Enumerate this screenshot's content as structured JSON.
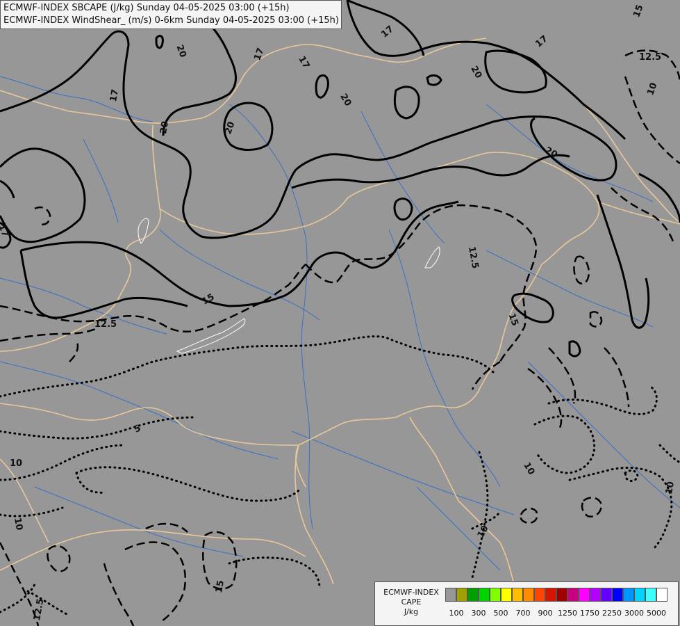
{
  "title": {
    "line1": "ECMWF-INDEX SBCAPE (J/kg) Sunday 04-05-2025 03:00 (+15h)",
    "line2": "ECMWF-INDEX WindShear_ (m/s) 0-6km Sunday 04-05-2025 03:00 (+15h)"
  },
  "colors": {
    "background": "#979797",
    "borders": "#e8c89a",
    "rivers": "#3a6fc4",
    "contours": "#000000"
  },
  "contour_labels": {
    "l20a": "20",
    "l20b": "20",
    "l20c": "20",
    "l20d": "20",
    "l20e": "20",
    "l17a": "17",
    "l17b": "17",
    "l17c": "17",
    "l17d": "17",
    "l17e": "17",
    "l15a": "15",
    "l15b": "15",
    "l15c": "15",
    "l15d": "15",
    "l125a": "12.5",
    "l125b": "12.5",
    "l125c": "12.5",
    "l125d": "12.5",
    "l10a": "10",
    "l10b": "10",
    "l10c": "10",
    "l10d": "10",
    "l10e": "10",
    "l5": "5"
  },
  "legend": {
    "title_line1": "ECMWF-INDEX",
    "title_line2": "CAPE",
    "title_line3": "J/kg",
    "swatch_colors": [
      "#979797",
      "#a0a000",
      "#00a000",
      "#00d400",
      "#7fff00",
      "#ffff00",
      "#ffbf00",
      "#ff8c00",
      "#ff4500",
      "#d41400",
      "#a00000",
      "#c8007f",
      "#ff00ff",
      "#b400ff",
      "#6400ff",
      "#0000ff",
      "#0096ff",
      "#00d4ff",
      "#40ffff",
      "#ffffff"
    ],
    "tick_labels": [
      "100",
      "300",
      "500",
      "700",
      "900",
      "1250",
      "1750",
      "2250",
      "3000",
      "5000"
    ]
  }
}
